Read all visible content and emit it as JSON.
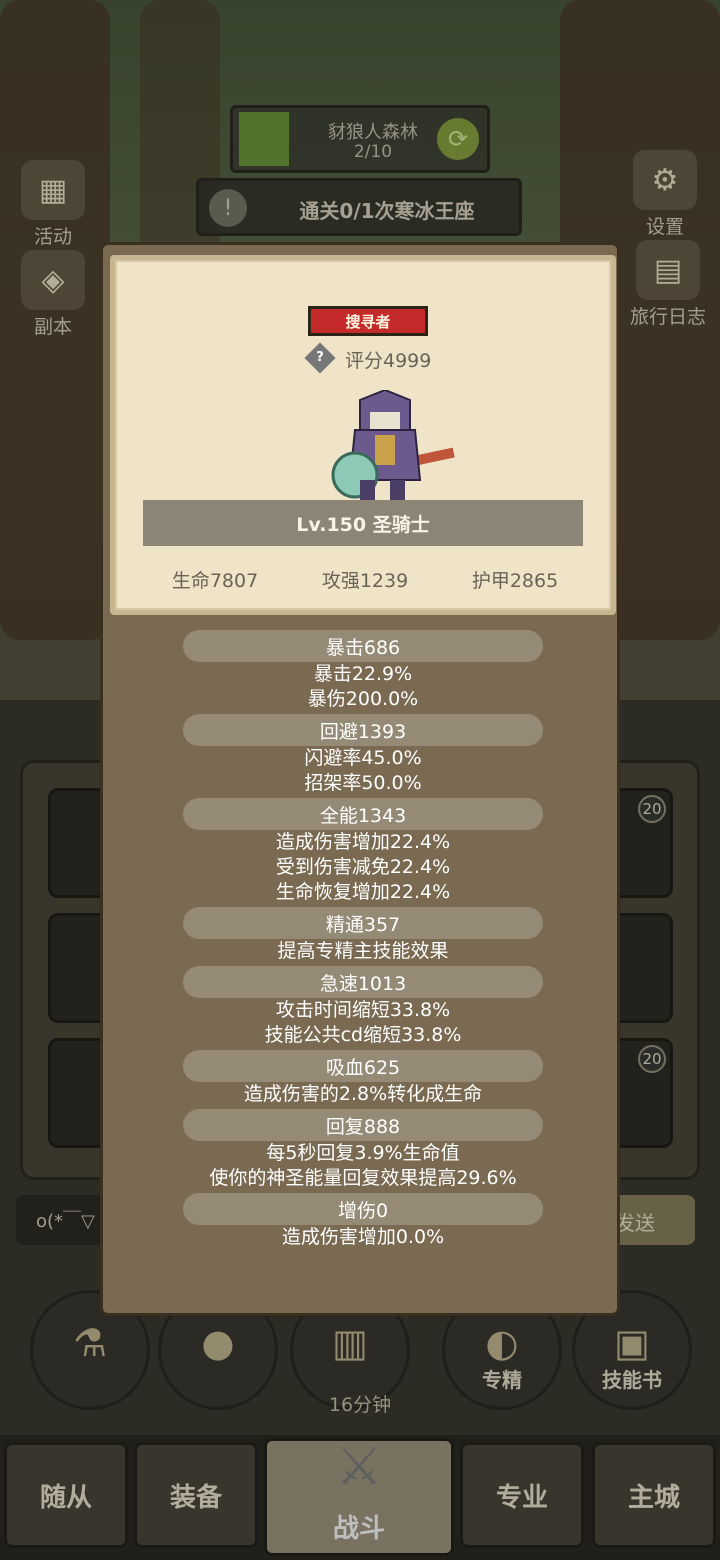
{
  "hud": {
    "area_title": "豺狼人森林",
    "area_progress": "2/10",
    "quest_text": "通关0/1次寒冰王座",
    "left_buttons": [
      {
        "label": "活动"
      },
      {
        "label": "副本"
      }
    ],
    "right_buttons": [
      {
        "label": "设置"
      },
      {
        "label": "旅行日志"
      }
    ],
    "chat_text": "o(*￣▽",
    "send_label": "发送",
    "slot_badges": [
      "20",
      "20"
    ]
  },
  "bottom": {
    "timer": "16分钟",
    "skill_buttons": [
      {
        "label": "",
        "icon": "potion-icon"
      },
      {
        "label": "",
        "icon": "bread-icon"
      },
      {
        "label": "",
        "icon": "chest-icon"
      },
      {
        "label": "专精",
        "icon": "specialization-icon"
      },
      {
        "label": "技能书",
        "icon": "skillbook-icon"
      }
    ],
    "tabs": [
      {
        "label": "随从"
      },
      {
        "label": "装备"
      },
      {
        "label": "战斗"
      },
      {
        "label": "专业"
      },
      {
        "label": "主城"
      }
    ]
  },
  "popup": {
    "rank_badge": "搜寻者",
    "score": "评分4999",
    "hero_name": "Lv.150 圣骑士",
    "base_stats": {
      "hp": "生命7807",
      "atk": "攻强1239",
      "armor": "护甲2865"
    },
    "groups": [
      {
        "head": "暴击686",
        "lines": [
          "暴击22.9%",
          "暴伤200.0%"
        ]
      },
      {
        "head": "回避1393",
        "lines": [
          "闪避率45.0%",
          "招架率50.0%"
        ]
      },
      {
        "head": "全能1343",
        "lines": [
          "造成伤害增加22.4%",
          "受到伤害减免22.4%",
          "生命恢复增加22.4%"
        ]
      },
      {
        "head": "精通357",
        "lines": [
          "提高专精主技能效果"
        ]
      },
      {
        "head": "急速1013",
        "lines": [
          "攻击时间缩短33.8%",
          "技能公共cd缩短33.8%"
        ]
      },
      {
        "head": "吸血625",
        "lines": [
          "造成伤害的2.8%转化成生命"
        ]
      },
      {
        "head": "回复888",
        "lines": [
          "每5秒回复3.9%生命值",
          "使你的神圣能量回复效果提高29.6%"
        ]
      },
      {
        "head": "增伤0",
        "lines": [
          "造成伤害增加0.0%"
        ]
      }
    ]
  },
  "colors": {
    "badge_red": "#c52a2a",
    "card_bg": "#efe3c8",
    "popup_bg": "#7a6a52",
    "stat_pill": "#958a76"
  }
}
